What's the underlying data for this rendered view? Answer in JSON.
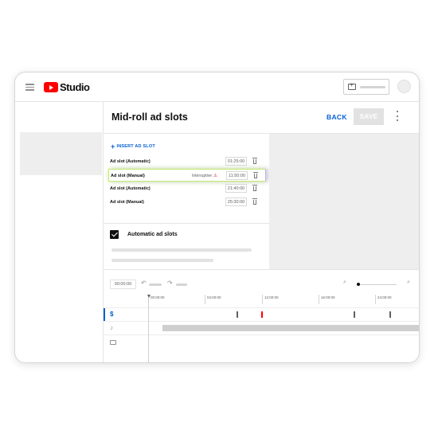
{
  "app": {
    "name": "Studio"
  },
  "header": {
    "title": "Mid-roll ad slots",
    "back_label": "BACK",
    "save_label": "SAVE"
  },
  "ad_slots": {
    "insert_label": "INSERT AD SLOT",
    "rows": [
      {
        "name": "Ad slot (Automatic)",
        "time": "01:25:00",
        "warning": ""
      },
      {
        "name": "Ad slot (Manual)",
        "time": "11:50:00",
        "warning": "Interruptive"
      },
      {
        "name": "Ad slot (Automatic)",
        "time": "21:40:00",
        "warning": ""
      },
      {
        "name": "Ad slot (Manual)",
        "time": "25:30:00",
        "warning": ""
      }
    ],
    "automatic_label": "Automatic ad slots",
    "automatic_checked": true
  },
  "timeline": {
    "timecode": "00:00:00",
    "ticks": [
      "00:00:00",
      "04:00:00",
      "12:00:00",
      "16:00:00",
      "24:00:00"
    ],
    "zoom_level": 0.0
  },
  "colors": {
    "brand_red": "#ff0000",
    "link_blue": "#065fd4",
    "highlight_green": "#c8e87a",
    "highlight_purple": "#b9b0ee"
  }
}
